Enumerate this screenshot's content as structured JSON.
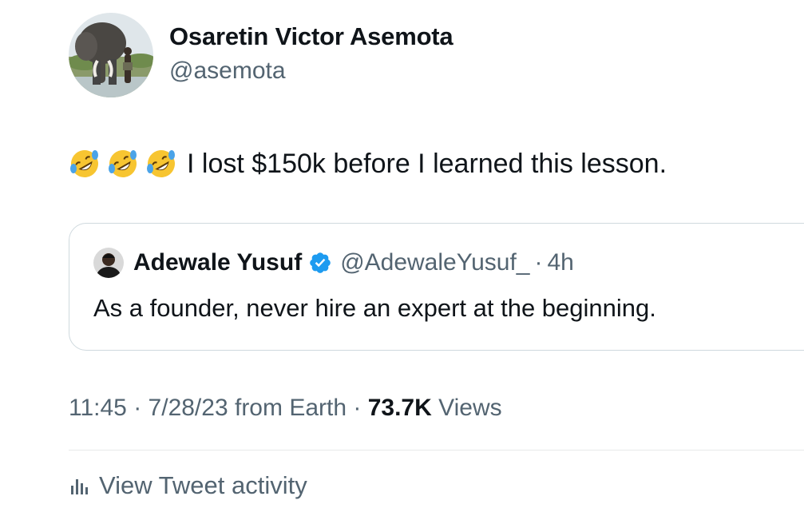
{
  "author": {
    "display_name": "Osaretin Victor Asemota",
    "handle": "@asemota",
    "avatar_icon": "elephant-photo-avatar"
  },
  "tweet": {
    "emojis": [
      "rolling-on-floor-laughing-emoji",
      "rolling-on-floor-laughing-emoji",
      "rolling-on-floor-laughing-emoji"
    ],
    "text": "I lost $150k before I learned this lesson."
  },
  "quoted_tweet": {
    "display_name": "Adewale Yusuf",
    "verified_icon": "verified-badge-icon",
    "handle": "@AdewaleYusuf_",
    "separator": "·",
    "time": "4h",
    "text": "As a founder, never hire an expert at the beginning."
  },
  "meta": {
    "time": "11:45",
    "sep1": "·",
    "date": "7/28/23",
    "source": "from Earth",
    "sep2": "·",
    "views_count": "73.7K",
    "views_label": "Views"
  },
  "activity": {
    "icon": "bar-chart-icon",
    "label": "View Tweet activity"
  },
  "colors": {
    "primary_text": "#0f1419",
    "secondary_text": "#536471",
    "border": "#cfd9de",
    "verified_blue": "#1d9bf0"
  }
}
